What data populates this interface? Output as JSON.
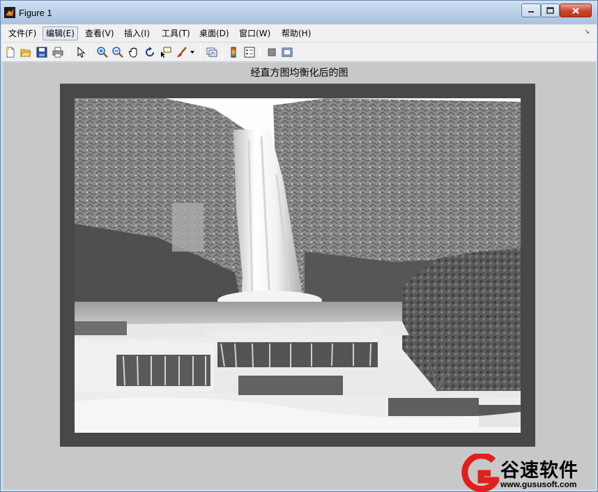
{
  "window": {
    "title": "Figure 1"
  },
  "menu": {
    "items": [
      {
        "label": "文件(F)"
      },
      {
        "label": "编辑(E)"
      },
      {
        "label": "查看(V)"
      },
      {
        "label": "插入(I)"
      },
      {
        "label": "工具(T)"
      },
      {
        "label": "桌面(D)"
      },
      {
        "label": "窗口(W)"
      },
      {
        "label": "帮助(H)"
      }
    ]
  },
  "toolbar": {
    "icons": [
      "new-figure-icon",
      "open-file-icon",
      "save-icon",
      "print-icon",
      "edit-plot-arrow-icon",
      "zoom-in-icon",
      "zoom-out-icon",
      "pan-hand-icon",
      "rotate-3d-icon",
      "data-cursor-icon",
      "brush-icon",
      "brush-dropdown-icon",
      "link-plot-icon",
      "colorbar-icon",
      "legend-icon",
      "hide-plot-tools-icon",
      "show-plot-tools-icon"
    ]
  },
  "axes": {
    "title": "经直方图均衡化后的图"
  },
  "watermark": {
    "name": "谷速软件",
    "url": "www.gususoft.com",
    "color": "#e0201c"
  },
  "colors": {
    "accent_close": "#c8452c",
    "figure_bg": "#c8c8c8"
  }
}
